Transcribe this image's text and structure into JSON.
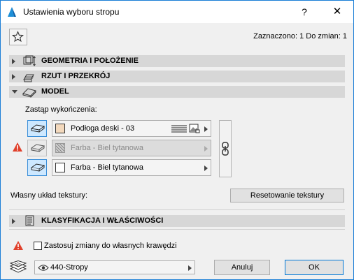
{
  "window": {
    "title": "Ustawienia wyboru stropu",
    "help": "?",
    "close": "✕"
  },
  "header": {
    "selection_info": "Zaznaczono: 1 Do zmian: 1"
  },
  "panels": {
    "geometry": "GEOMETRIA I POŁOŻENIE",
    "plan": "RZUT I PRZEKRÓJ",
    "model": "MODEL",
    "classification": "KLASYFIKACJA I WŁAŚCIWOŚCI"
  },
  "model": {
    "override_label": "Zastąp wykończenia:",
    "materials": [
      {
        "name": "Podłoga deski - 03",
        "swatch": "#f3d9bd",
        "enabled": true
      },
      {
        "name": "Farba - Biel tytanowa",
        "swatch": "hatch",
        "enabled": false
      },
      {
        "name": "Farba - Biel tytanowa",
        "swatch": "#ffffff",
        "enabled": true
      }
    ],
    "texture_label": "Własny układ tekstury:",
    "reset_texture": "Resetowanie tekstury"
  },
  "footer": {
    "apply_label": "Zastosuj zmiany do własnych krawędzi",
    "layer": "440-Stropy",
    "cancel": "Anuluj",
    "ok": "OK"
  },
  "colors": {
    "accent": "#0078d7",
    "warning": "#e0402b"
  }
}
